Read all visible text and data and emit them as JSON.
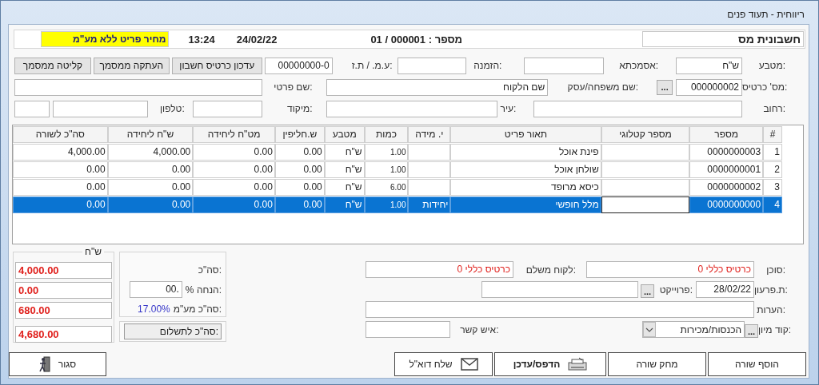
{
  "window": {
    "title": "ריווחית - תעוד פנים"
  },
  "header": {
    "doc_type": "חשבונית מס",
    "number_label": "מספר :",
    "number": "000001 / 01",
    "date": "24/02/22",
    "time": "13:24",
    "price_mode": "מחיר פריט ללא מע\"מ"
  },
  "details": {
    "currency_label": "מטבע:",
    "currency": "ש\"ח",
    "reference_label": "אסמכתא:",
    "order_label": "הזמנה:",
    "tax_id_label": "ע.מ. / ת.ז:",
    "tax_id": "00000000-0",
    "card_label": "מס' כרטיס:",
    "card": "000000002",
    "card_lookup": "...",
    "last_name_label": "שם משפחה/עסק:",
    "last_name": "שם הלקוח",
    "first_name_label": "שם פרטי:",
    "street_label": "רחוב:",
    "city_label": "עיר:",
    "zip_label": "מיקוד:",
    "phone_label": "טלפון:"
  },
  "actions": [
    "עדכון כרטיס חשבון",
    "העתקה ממסמך",
    "קליטה ממסמך"
  ],
  "table": {
    "columns": [
      "#",
      "מספר",
      "מספר קטלוגי",
      "תאור פריט",
      "י. מידה",
      "כמות",
      "מטבע",
      "ש.חליפין",
      "מט\"ח ליחידה",
      "ש\"ח ליחידה",
      "סה\"כ לשורה"
    ],
    "rows": [
      {
        "index": "1",
        "number": "0000000003",
        "description": "פינת אוכל",
        "quantity": "1.00",
        "currency": "ש\"ח",
        "rate": "0.00",
        "foreign_unit": "0.00",
        "unit_price": "4,000.00",
        "line_total": "4,000.00",
        "selected": false,
        "editing": false
      },
      {
        "index": "2",
        "number": "0000000001",
        "description": "שולחן אוכל",
        "quantity": "1.00",
        "currency": "ש\"ח",
        "rate": "0.00",
        "foreign_unit": "0.00",
        "unit_price": "0.00",
        "line_total": "0.00",
        "selected": false,
        "editing": false
      },
      {
        "index": "3",
        "number": "0000000002",
        "description": "כיסא מרופד",
        "quantity": "6.00",
        "currency": "ש\"ח",
        "rate": "0.00",
        "foreign_unit": "0.00",
        "unit_price": "0.00",
        "line_total": "0.00",
        "selected": false,
        "editing": false
      },
      {
        "index": "4",
        "number": "0000000000",
        "description": "מלל חופשי",
        "unit": "יחידות",
        "quantity": "1.00",
        "currency": "ש\"ח",
        "rate": "0.00",
        "foreign_unit": "0.00",
        "unit_price": "0.00",
        "line_total": "0.00",
        "selected": true,
        "editing": true
      }
    ]
  },
  "footer": {
    "agent_label": "סוכן:",
    "agent": "כרטיס כללי 0",
    "payer_label": "לקוח משלם:",
    "payer": "כרטיס כללי 0",
    "due_label": "ת.פרעון:",
    "due_date": "28/02/22",
    "project_label": "פרוייקט:",
    "project_lookup": "...",
    "notes_label": "הערות:",
    "sort_label": "קוד מיון:",
    "sort_lookup": "...",
    "sort_value": "הכנסות/מכירות",
    "contact_label": "איש קשר:"
  },
  "totals": {
    "currency": "ש\"ח",
    "total_label": "סה\"כ:",
    "total": "4,000.00",
    "discount_label": "% הנחה:",
    "discount_rate": ".00",
    "discount": "0.00",
    "vat_label": "סה\"כ מע\"מ:",
    "vat_rate": "17.00%",
    "vat": "680.00",
    "payable_label": "סה\"כ לתשלום:",
    "payable": "4,680.00"
  },
  "buttons": [
    {
      "label": "הוסף שורה",
      "kind": "plain"
    },
    {
      "label": "מחק שורה",
      "kind": "plain"
    },
    {
      "label": "הדפס/עדכן",
      "kind": "print"
    },
    {
      "label": "שלח דוא\"ל",
      "kind": "email"
    },
    {
      "label": "סגור",
      "kind": "exit"
    }
  ]
}
